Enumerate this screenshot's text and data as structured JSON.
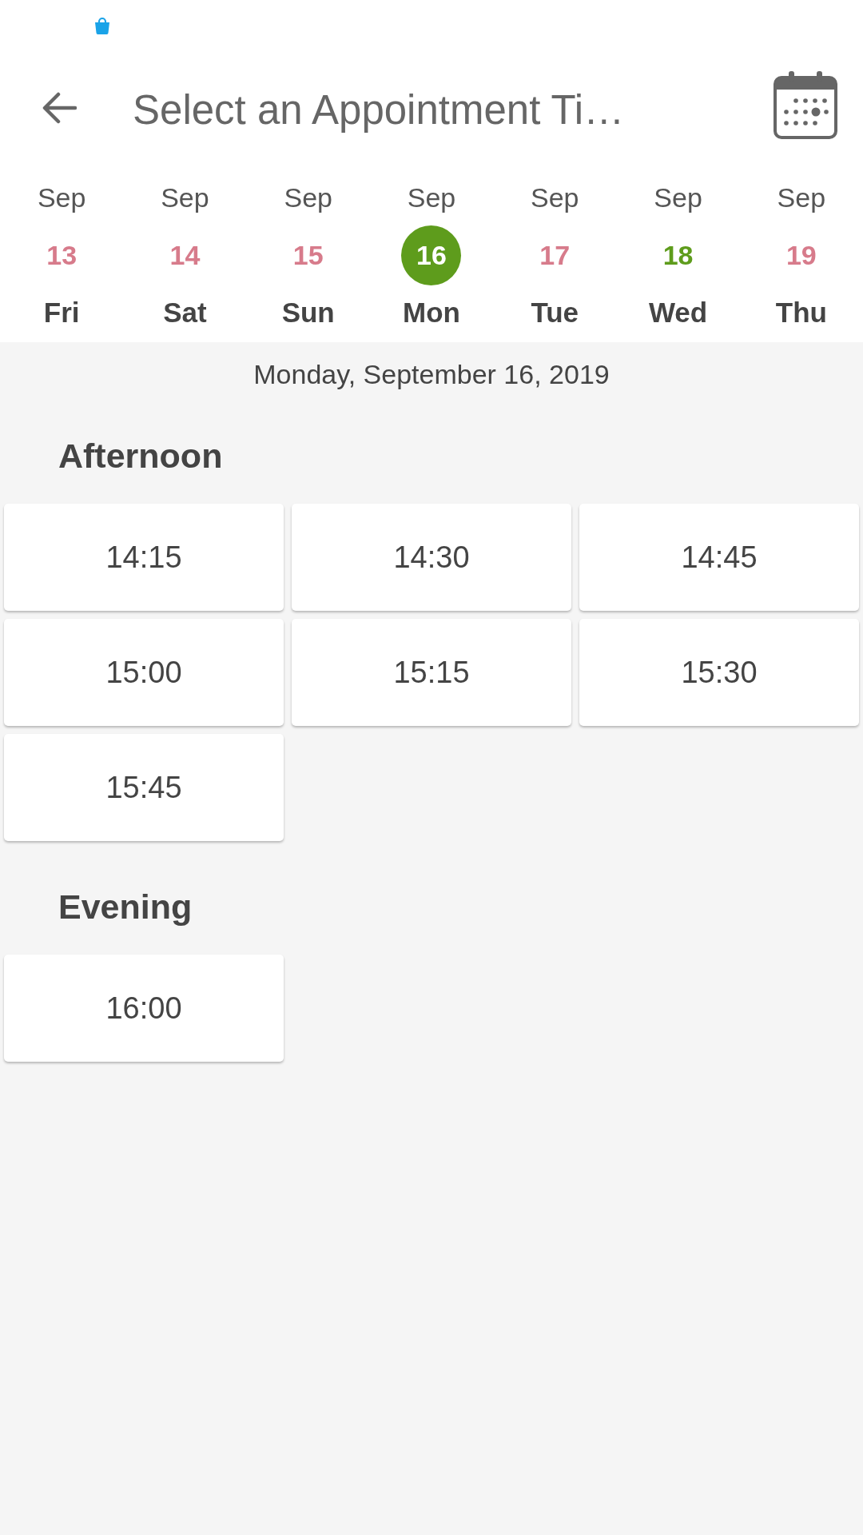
{
  "header": {
    "title": "Select an Appointment Ti…"
  },
  "days": [
    {
      "month": "Sep",
      "date": "13",
      "weekday": "Fri",
      "selected": false,
      "available": false
    },
    {
      "month": "Sep",
      "date": "14",
      "weekday": "Sat",
      "selected": false,
      "available": false
    },
    {
      "month": "Sep",
      "date": "15",
      "weekday": "Sun",
      "selected": false,
      "available": false
    },
    {
      "month": "Sep",
      "date": "16",
      "weekday": "Mon",
      "selected": true,
      "available": true
    },
    {
      "month": "Sep",
      "date": "17",
      "weekday": "Tue",
      "selected": false,
      "available": false
    },
    {
      "month": "Sep",
      "date": "18",
      "weekday": "Wed",
      "selected": false,
      "available": true
    },
    {
      "month": "Sep",
      "date": "19",
      "weekday": "Thu",
      "selected": false,
      "available": false
    }
  ],
  "selected_date": "Monday, September 16, 2019",
  "sections": [
    {
      "title": "Afternoon",
      "slots": [
        "14:15",
        "14:30",
        "14:45",
        "15:00",
        "15:15",
        "15:30",
        "15:45"
      ]
    },
    {
      "title": "Evening",
      "slots": [
        "16:00"
      ]
    }
  ]
}
